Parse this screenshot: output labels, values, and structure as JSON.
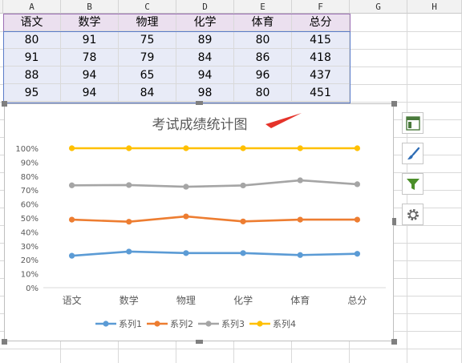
{
  "sheet": {
    "columns": [
      "A",
      "B",
      "C",
      "D",
      "E",
      "F",
      "G",
      "H"
    ],
    "table_headers": [
      "语文",
      "数学",
      "物理",
      "化学",
      "体育",
      "总分"
    ],
    "table_rows": [
      [
        "80",
        "91",
        "75",
        "89",
        "80",
        "415"
      ],
      [
        "91",
        "78",
        "79",
        "84",
        "86",
        "418"
      ],
      [
        "88",
        "94",
        "65",
        "94",
        "96",
        "437"
      ],
      [
        "95",
        "94",
        "84",
        "98",
        "80",
        "451"
      ]
    ]
  },
  "chart_data": {
    "type": "line",
    "title": "考试成绩统计图",
    "categories": [
      "语文",
      "数学",
      "物理",
      "化学",
      "体育",
      "总分"
    ],
    "y_ticks": [
      "0%",
      "10%",
      "20%",
      "30%",
      "40%",
      "50%",
      "60%",
      "70%",
      "80%",
      "90%",
      "100%"
    ],
    "ylim": [
      0,
      1
    ],
    "grid": false,
    "legend_position": "bottom",
    "series": [
      {
        "name": "系列1",
        "color": "#5b9bd5",
        "values": [
          0.229,
          0.259,
          0.248,
          0.248,
          0.234,
          0.243
        ]
      },
      {
        "name": "系列2",
        "color": "#ed7d31",
        "values": [
          0.488,
          0.473,
          0.511,
          0.475,
          0.488,
          0.488
        ]
      },
      {
        "name": "系列3",
        "color": "#a5a5a5",
        "values": [
          0.734,
          0.736,
          0.724,
          0.733,
          0.77,
          0.742
        ]
      },
      {
        "name": "系列4",
        "color": "#ffc000",
        "values": [
          1.0,
          1.0,
          1.0,
          1.0,
          1.0,
          1.0
        ]
      }
    ]
  },
  "side_buttons": [
    "chart-elements-icon",
    "chart-styles-icon",
    "chart-filter-icon",
    "settings-icon"
  ],
  "colors": {
    "arrow": "#e5332a"
  }
}
